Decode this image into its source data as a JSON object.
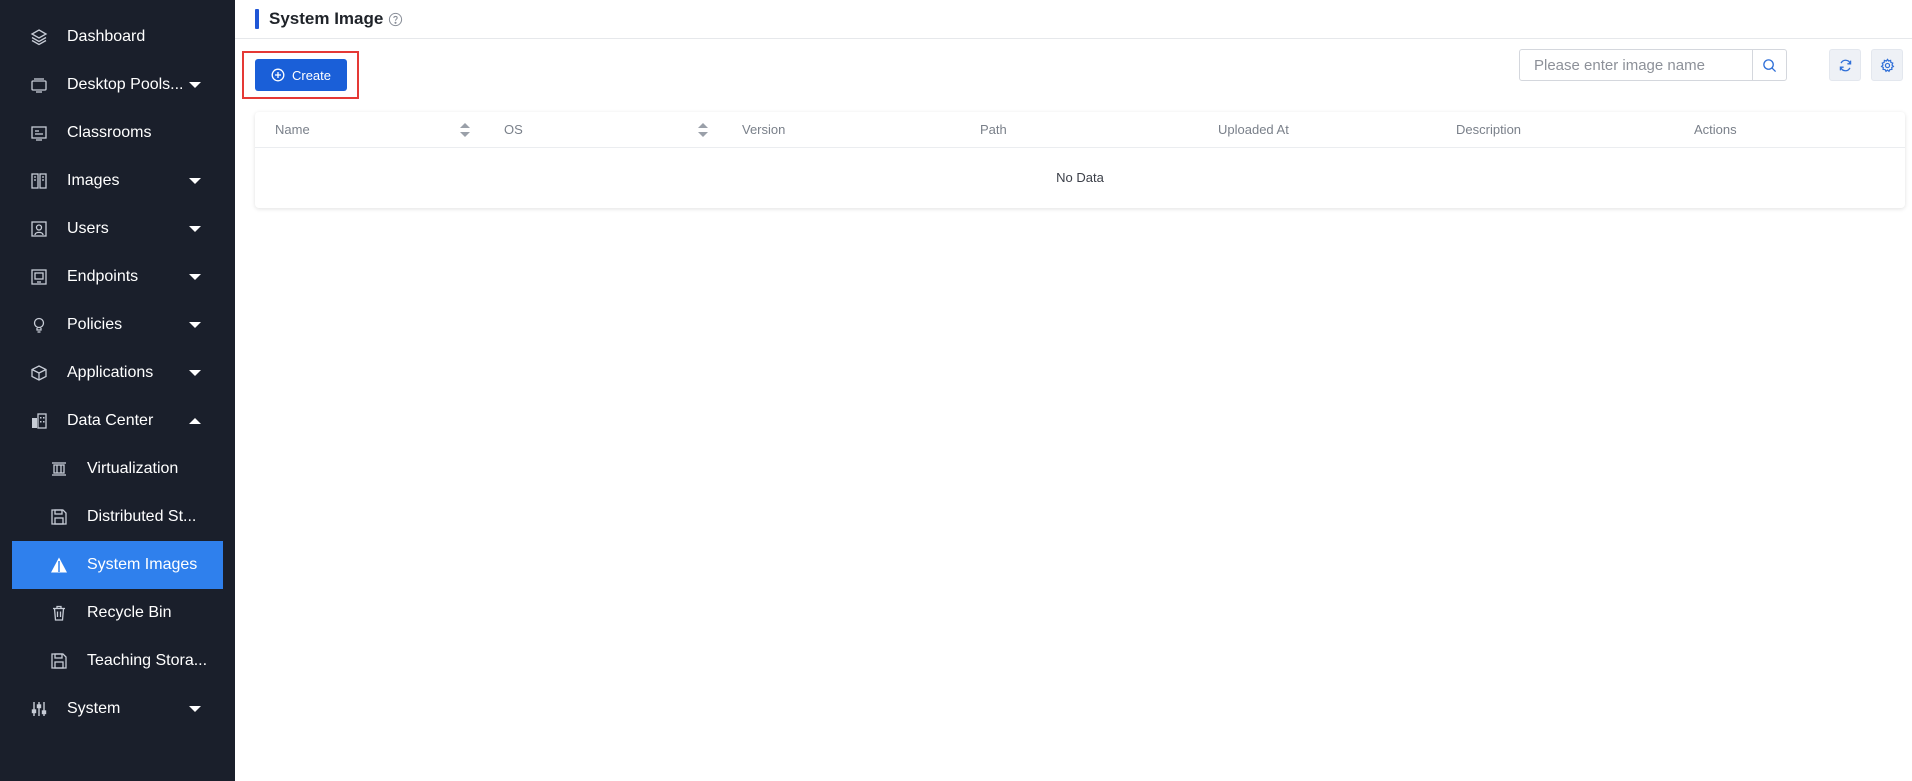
{
  "sidebar": {
    "items": [
      {
        "label": "Dashboard",
        "icon": "layers-icon"
      },
      {
        "label": "Desktop Pools...",
        "icon": "desktop-pools-icon"
      },
      {
        "label": "Classrooms",
        "icon": "classroom-icon"
      },
      {
        "label": "Images",
        "icon": "images-icon"
      },
      {
        "label": "Users",
        "icon": "users-icon"
      },
      {
        "label": "Endpoints",
        "icon": "endpoints-icon"
      },
      {
        "label": "Policies",
        "icon": "lightbulb-icon"
      },
      {
        "label": "Applications",
        "icon": "cube-icon"
      },
      {
        "label": "Data Center",
        "icon": "buildings-icon"
      },
      {
        "label": "Virtualization",
        "icon": "server-icon"
      },
      {
        "label": "Distributed St...",
        "icon": "storage-icon"
      },
      {
        "label": "System Images",
        "icon": "triangle-icon"
      },
      {
        "label": "Recycle Bin",
        "icon": "trash-icon"
      },
      {
        "label": "Teaching Stora...",
        "icon": "storage-icon"
      },
      {
        "label": "System",
        "icon": "sliders-icon"
      }
    ],
    "active_item": "System Images"
  },
  "header": {
    "title": "System Image",
    "help_icon": "question-circle-icon"
  },
  "toolbar": {
    "create_label": "Create",
    "search_placeholder": "Please enter image name",
    "search_value": ""
  },
  "table": {
    "columns": [
      "Name",
      "OS",
      "Version",
      "Path",
      "Uploaded At",
      "Description",
      "Actions"
    ],
    "sortable": [
      "Name",
      "OS"
    ],
    "rows": [],
    "empty_text": "No Data"
  },
  "colors": {
    "sidebar_bg": "#1a1f2b",
    "active_item_bg": "#2f80ed",
    "primary_button": "#1a5fd8",
    "highlight_border": "#e53935",
    "title_accent": "#1f56d6"
  }
}
